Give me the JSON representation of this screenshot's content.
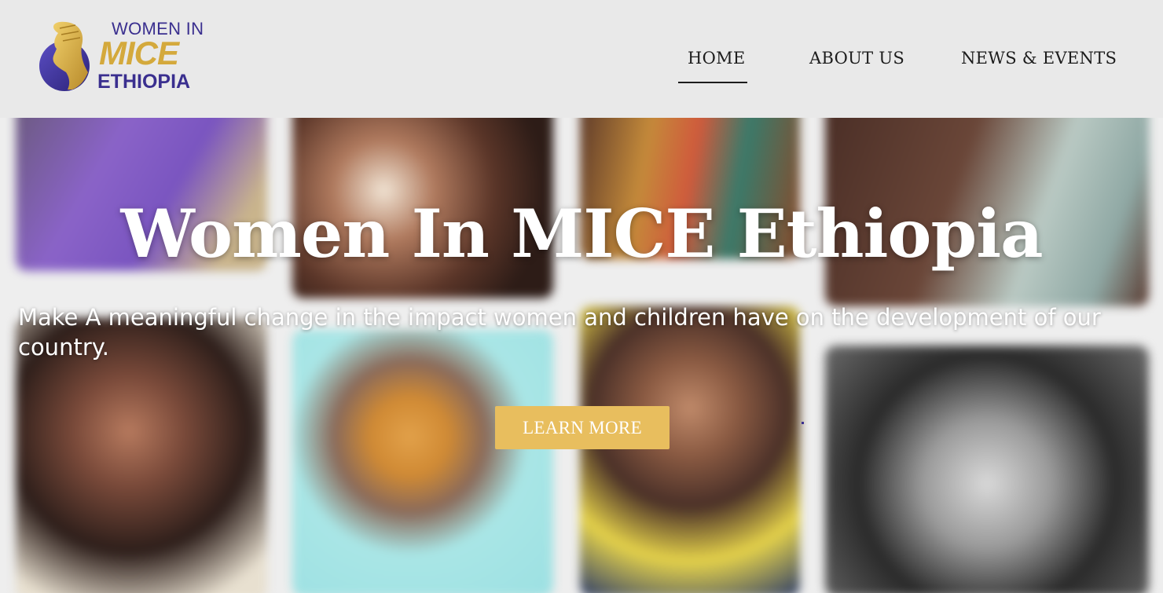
{
  "header": {
    "logo": {
      "line1": "WOMEN IN",
      "line2": "MICE",
      "line3": "ETHIOPIA",
      "colors": {
        "purple": "#3a2f8f",
        "gold": "#d4a93c"
      },
      "icon": "woman-profile-icon"
    },
    "nav": [
      {
        "label": "HOME",
        "active": true
      },
      {
        "label": "ABOUT US",
        "active": false
      },
      {
        "label": "NEWS & EVENTS",
        "active": false
      }
    ]
  },
  "hero": {
    "title": "Women In MICE Ethiopia",
    "subtitle": "Make A meaningful change in the impact women and children have on the development of our country.",
    "button": "LEARN MORE",
    "button_color": "#e8be5e"
  }
}
